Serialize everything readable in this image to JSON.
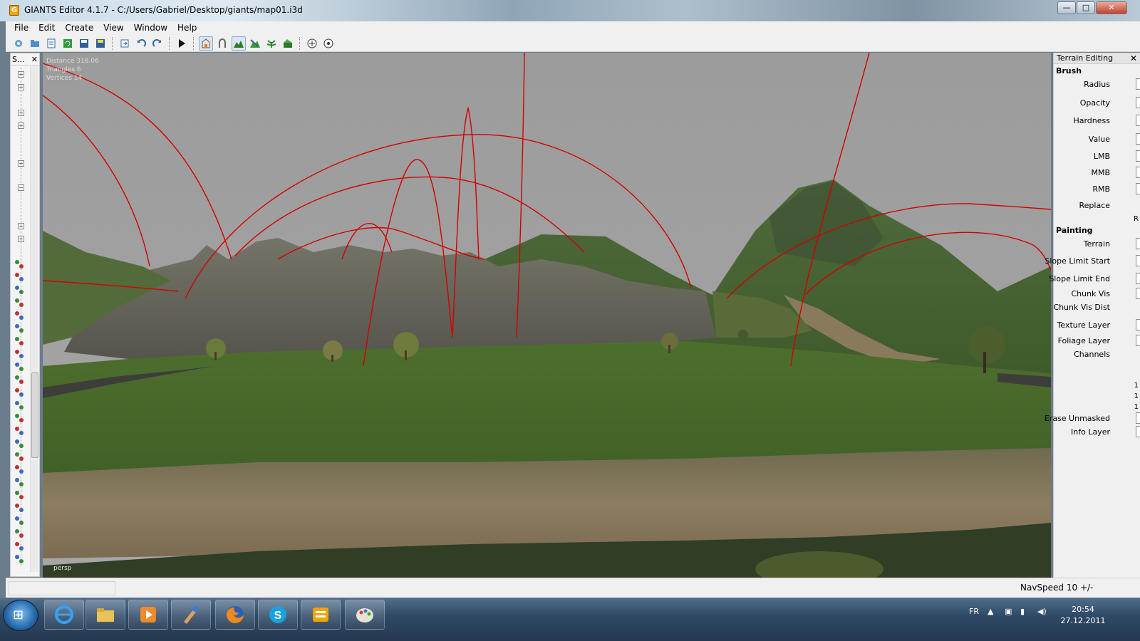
{
  "window": {
    "title": "GIANTS Editor 4.1.7 - C:/Users/Gabriel/Desktop/giants/map01.i3d",
    "buttons": {
      "minimize": "—",
      "maximize": "□",
      "close": "✕"
    }
  },
  "menu": [
    {
      "label": "File"
    },
    {
      "label": "Edit"
    },
    {
      "label": "Create"
    },
    {
      "label": "View"
    },
    {
      "label": "Window"
    },
    {
      "label": "Help"
    }
  ],
  "toolbar": {
    "icons": [
      "new-icon",
      "open-icon",
      "properties-icon",
      "refresh-icon",
      "save-icon",
      "save-all-icon",
      "import-icon",
      "undo-icon",
      "redo-icon",
      "play-icon",
      "select-mode-icon",
      "move-mode-icon",
      "terrain-sculpt-icon",
      "terrain-paint-icon",
      "foliage-paint-icon",
      "terrain-layer-icon",
      "snap-grid-icon",
      "snap-object-icon"
    ]
  },
  "scenegraph": {
    "title": "S...",
    "close": "✕"
  },
  "viewport": {
    "stats": [
      "Distance 318.06",
      "Triangles 6",
      "Vertices 14"
    ],
    "camera_label": "persp",
    "colors": {
      "sky": "#9a9a9a",
      "grass": "#4b6b2c",
      "rock": "#6b6a63",
      "dirt": "#8a7a5e",
      "spline": "#d40000"
    }
  },
  "terrain_panel": {
    "title": "Terrain Editing",
    "close": "✕",
    "brush_heading": "Brush",
    "brush_fields": [
      "Radius",
      "Opacity",
      "Hardness",
      "Value",
      "LMB",
      "MMB",
      "RMB",
      "Replace"
    ],
    "replace_value": "R",
    "painting_heading": "Painting",
    "painting_fields": [
      "Terrain",
      "Slope Limit Start",
      "Slope Limit End",
      "Chunk Vis",
      "Chunk Vis Dist",
      "Texture Layer",
      "Foliage Layer",
      "Channels"
    ],
    "channel_values": [
      "1",
      "1",
      "1"
    ],
    "extra_fields": [
      "Erase Unmasked",
      "Info Layer"
    ]
  },
  "status": {
    "nav_speed": "NavSpeed 10 +/-"
  },
  "taskbar": {
    "apps": [
      "internet-explorer-icon",
      "file-explorer-icon",
      "media-player-icon",
      "paint-tool-icon",
      "firefox-icon",
      "skype-icon",
      "giants-editor-icon",
      "paint-palette-icon"
    ],
    "language": "FR",
    "time": "20:54",
    "date": "27.12.2011"
  }
}
